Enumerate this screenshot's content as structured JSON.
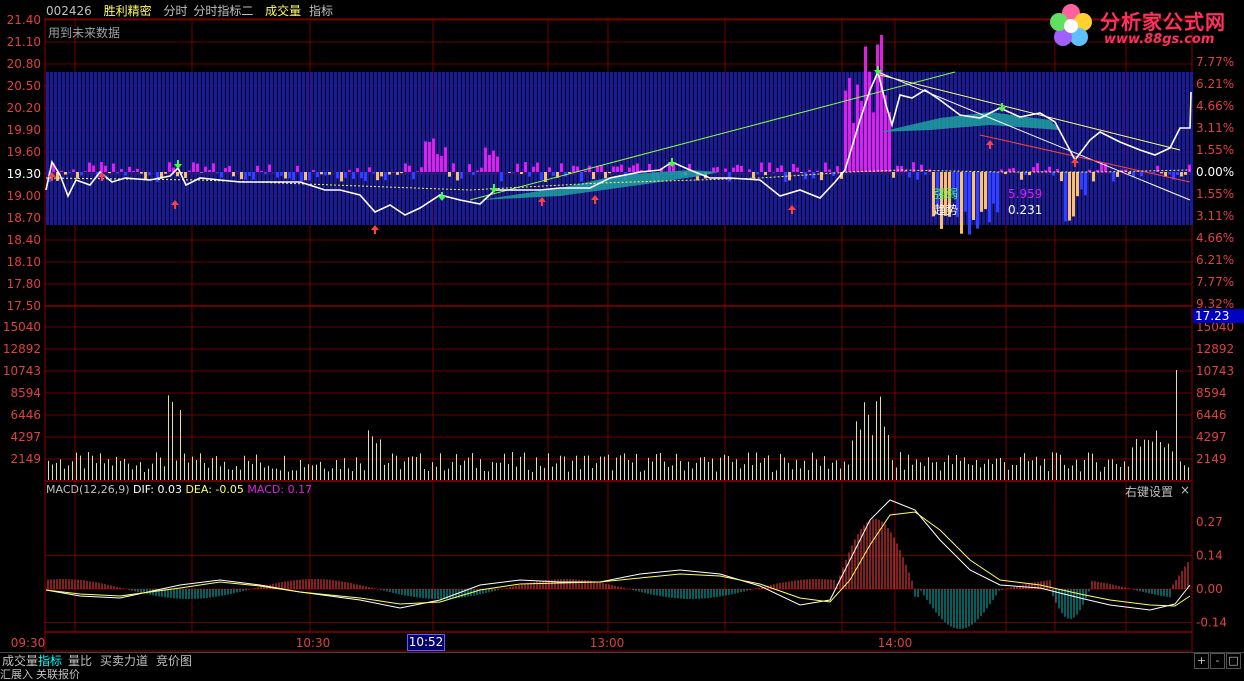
{
  "header": {
    "code": "002426",
    "name": "胜利精密",
    "items": [
      "分时",
      "分时指标二",
      "成交量",
      "指标"
    ]
  },
  "watermark": {
    "title": "分析家公式网",
    "url": "www.88gs.com"
  },
  "future_note": "用到未来数据",
  "price_axis_left": [
    "21.40",
    "21.10",
    "20.80",
    "20.50",
    "20.20",
    "19.90",
    "19.60",
    "19.30",
    "19.00",
    "18.70",
    "18.40",
    "18.10",
    "17.80",
    "17.50"
  ],
  "pct_axis_right": [
    "7.77%",
    "6.21%",
    "4.66%",
    "3.11%",
    "1.55%",
    "0.00%",
    "1.55%",
    "3.11%",
    "4.66%",
    "6.21%",
    "7.77%",
    "9.32%"
  ],
  "volume_axis": [
    "15040",
    "12892",
    "10743",
    "8594",
    "6446",
    "4297",
    "2149"
  ],
  "macd_axis": [
    "0.27",
    "0.14",
    "0.00",
    "-0.14"
  ],
  "current_price": "17.23",
  "time_axis": [
    "09:30",
    "10:30",
    "13:00",
    "14:00"
  ],
  "cursor_time": "10:52",
  "indicator_labels": {
    "label1": "强弱",
    "value1": "5.959",
    "label2": "趋势",
    "value2": "0.231"
  },
  "macd": {
    "name": "MACD(12,26,9)",
    "dif_label": "DIF:",
    "dif": "0.03",
    "dea_label": "DEA:",
    "dea": "-0.05",
    "macd_label": "MACD:",
    "macd": "0.17",
    "right_key": "右键设置",
    "close": "×"
  },
  "bottom_tabs": [
    "成交量",
    "指标",
    "量比",
    "买卖力道",
    "竞价图"
  ],
  "bottom_tabs2": [
    "汇展入",
    "关联报价"
  ],
  "controls": [
    "+",
    "-",
    "□"
  ],
  "colors": {
    "grid": "#8b0000",
    "axis_text": "#e04040",
    "white_line": "#ffffff",
    "yellow_line": "#ffff60",
    "up": "#ff4040",
    "down": "#00c0c0",
    "magenta": "#e020e0",
    "blue_band": "#1a1aa0",
    "volume": "#e0e0a0"
  }
}
